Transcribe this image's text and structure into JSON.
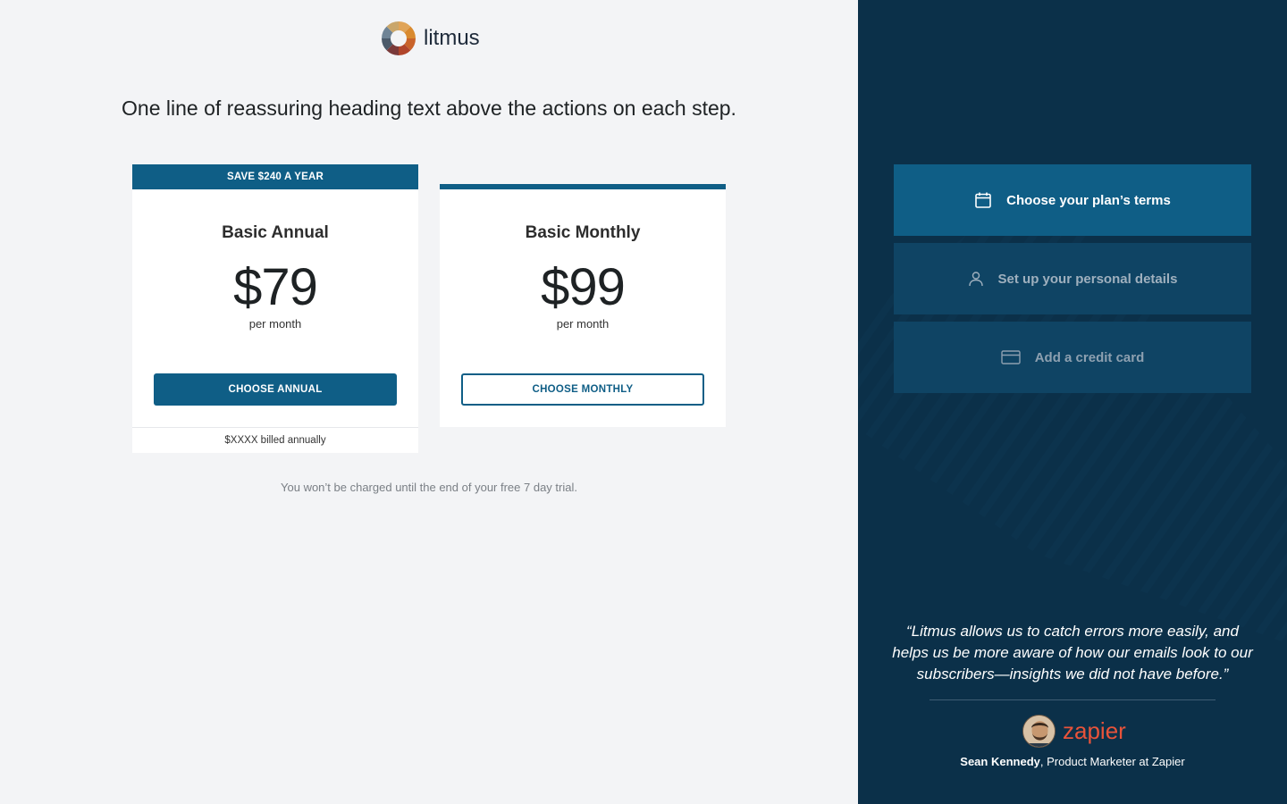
{
  "brand": {
    "name": "litmus",
    "accent": "#0f5e86",
    "sidebar_bg": "#0b3049"
  },
  "heading": "One line of reassuring heading text above the actions on each step.",
  "plans": {
    "annual": {
      "banner": "SAVE $240 A YEAR",
      "name": "Basic Annual",
      "price": "$79",
      "period": "per month",
      "button": "CHOOSE ANNUAL",
      "billed": "$XXXX billed annually"
    },
    "monthly": {
      "name": "Basic Monthly",
      "price": "$99",
      "period": "per month",
      "button": "CHOOSE MONTHLY"
    }
  },
  "trial_note": "You won’t be charged until the end of your free 7 day trial.",
  "steps": [
    {
      "label": "Choose your plan’s terms",
      "icon": "calendar-icon",
      "state": "active"
    },
    {
      "label": "Set up your personal details",
      "icon": "user-icon",
      "state": "inactive"
    },
    {
      "label": "Add a credit card",
      "icon": "credit-card-icon",
      "state": "inactive"
    }
  ],
  "testimonial": {
    "quote": "“Litmus allows us to catch errors more easily, and helps us be more aware of how our emails look to our subscribers—insights we did not have before.”",
    "company": "zapier",
    "person": "Sean Kennedy",
    "role": ", Product Marketer at Zapier"
  }
}
